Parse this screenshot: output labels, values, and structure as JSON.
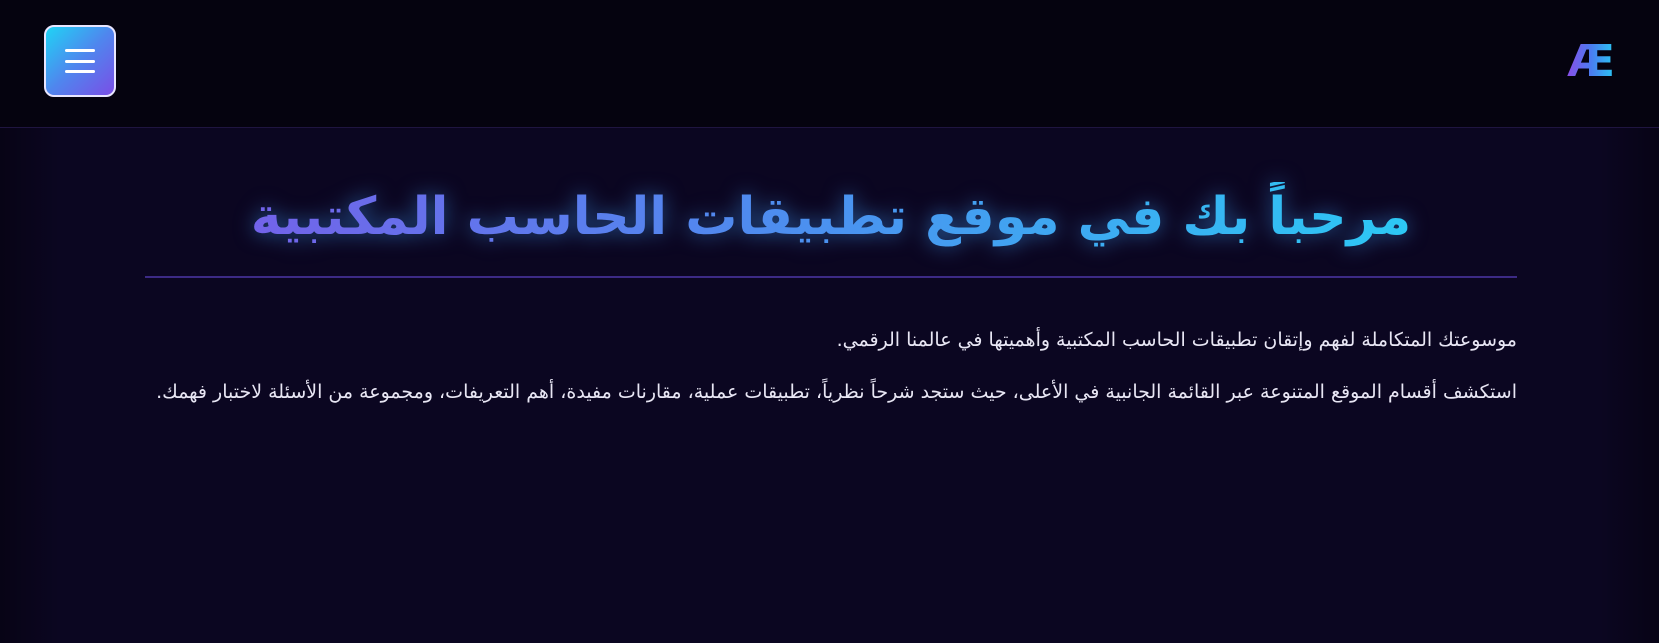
{
  "header": {
    "menu_icon": "hamburger-menu-icon",
    "logo_text": "Æ",
    "colors": {
      "bar_background": "#05030f",
      "button_gradient_start": "#1fd4f5",
      "button_gradient_end": "#7a4ee6"
    }
  },
  "main": {
    "title": "مرحباً بك في موقع تطبيقات الحاسب المكتبية",
    "intro": "موسوعتك المتكاملة لفهم وإتقان تطبيقات الحاسب المكتبية وأهميتها في عالمنا الرقمي.",
    "explore": "استكشف أقسام الموقع المتنوعة عبر القائمة الجانبية في الأعلى، حيث ستجد شرحاً نظرياً، تطبيقات عملية، مقارنات مفيدة، أهم التعريفات، ومجموعة من الأسئلة لاختبار فهمك.",
    "colors": {
      "page_background": "#0b0621",
      "title_gradient_start": "#27d2f5",
      "title_gradient_end": "#7a5ae8",
      "divider": "#3c2a85",
      "text": "#e8e6f4"
    }
  }
}
